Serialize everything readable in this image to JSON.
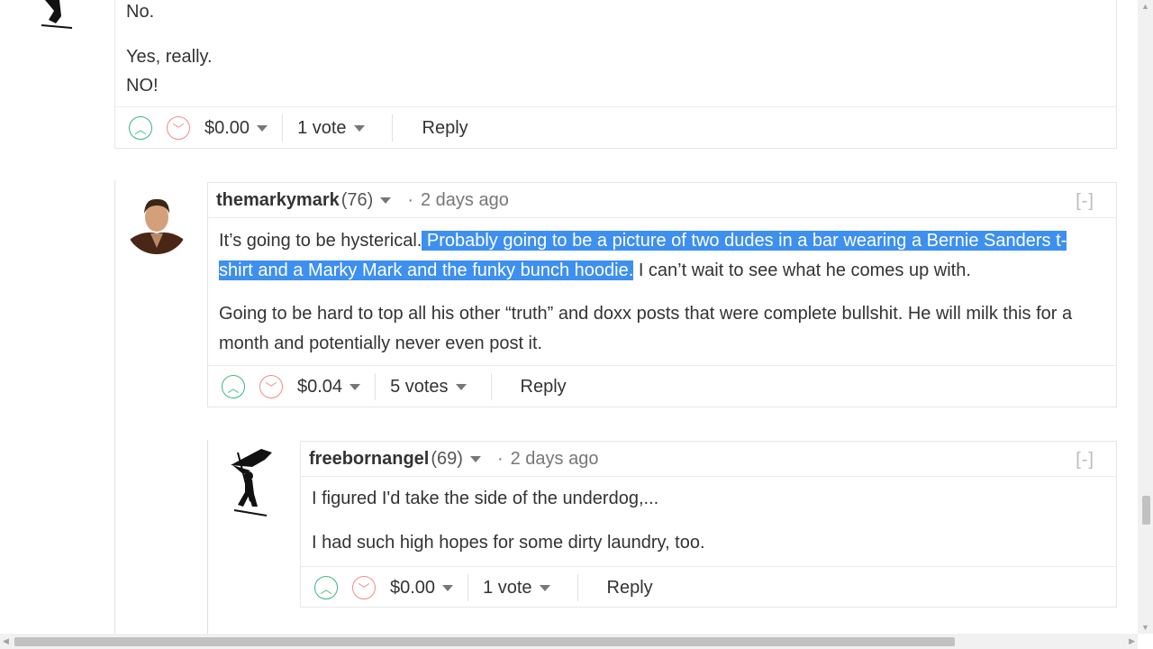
{
  "comment1": {
    "lines": [
      "No.",
      "Yes, really.",
      "NO!"
    ],
    "payout": "$0.00",
    "votes": "1 vote",
    "reply": "Reply"
  },
  "comment2": {
    "author": "themarkymark",
    "reputation": "(76)",
    "dot": "·",
    "time": "2 days ago",
    "collapse": "[-]",
    "p1_before": "It’s going to be hysterical.",
    "p1_selected_a": " Probably going to be a picture of two dudes in a bar wearing a Bernie Sanders t-",
    "p1_selected_b": "shirt and a Marky Mark and the funky bunch hoodie.",
    "p1_after": " I can’t wait to see what he comes up with.",
    "p2": "Going to be hard to top all his other “truth” and doxx posts that were complete bullshit. He will milk this for a month and potentially never even post it.",
    "payout": "$0.04",
    "votes": "5 votes",
    "reply": "Reply"
  },
  "comment3": {
    "author": "freebornangel",
    "reputation": "(69)",
    "dot": "·",
    "time": "2 days ago",
    "collapse": "[-]",
    "p1": "I figured I'd take the side of the underdog,...",
    "p2": "I had such high hopes for some dirty laundry, too.",
    "payout": "$0.00",
    "votes": "1 vote",
    "reply": "Reply"
  },
  "icons": {
    "upvote": "chevron-up-icon",
    "downvote": "chevron-down-icon",
    "dropdown": "caret-down-icon"
  },
  "colors": {
    "upvote": "#3ab77e",
    "downvote": "#f08c8c",
    "selection": "#3d8ff0"
  }
}
